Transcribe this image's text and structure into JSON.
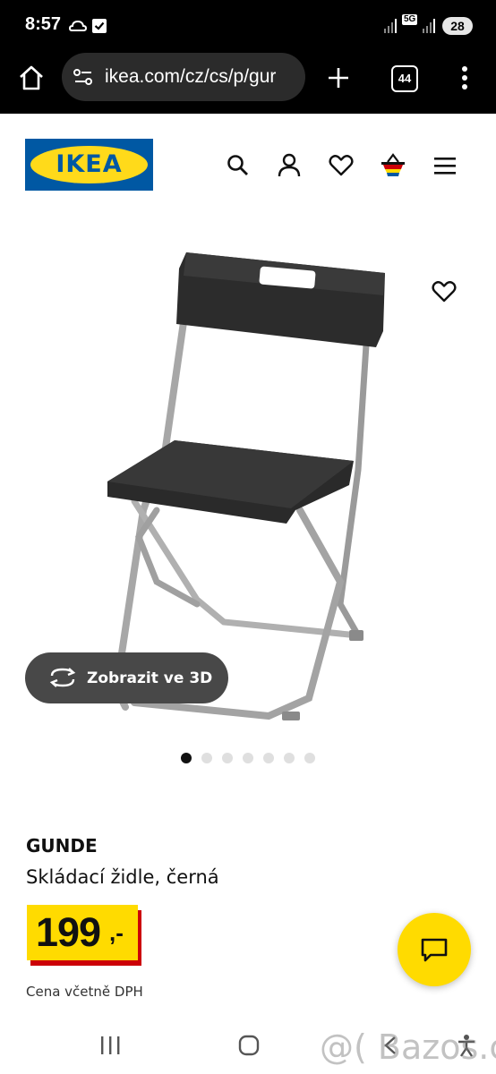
{
  "status_bar": {
    "time": "8:57",
    "network_badge": "5G",
    "battery": "28"
  },
  "browser": {
    "url": "ikea.com/cz/cs/p/gur",
    "tab_count": "44",
    "icons": [
      "home-icon",
      "site-settings-icon",
      "new-tab-icon",
      "tabs-icon",
      "more-icon"
    ]
  },
  "header": {
    "logo": "IKEA",
    "icons": [
      "search-icon",
      "user-icon",
      "heart-icon",
      "basket-icon",
      "menu-icon"
    ]
  },
  "gallery": {
    "view_3d_label": "Zobrazit ve 3D",
    "dots_total": 7,
    "dots_active_index": 0
  },
  "product": {
    "name": "GUNDE",
    "description": "Skládací židle, černá",
    "price": "199",
    "price_suffix": ",-",
    "vat_note": "Cena včetně DPH"
  },
  "watermark": "@( Bazos.cz",
  "colors": {
    "ikea_blue": "#0058a3",
    "ikea_yellow": "#ffdb00",
    "price_shadow": "#cc0008",
    "chrome_bg": "#000000",
    "pill_bg": "#484848"
  }
}
